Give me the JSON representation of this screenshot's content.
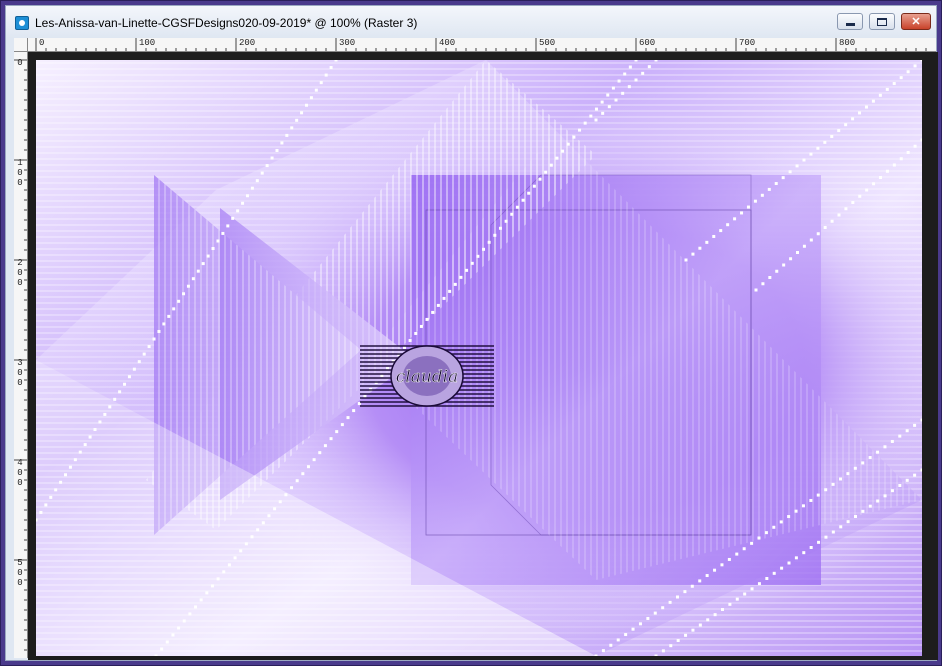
{
  "window": {
    "title": "Les-Anissa-van-Linette-CGSFDesigns020-09-2019* @ 100% (Raster 3)",
    "minimize_icon": "minimize-icon",
    "maximize_icon": "maximize-icon",
    "close_icon": "close-icon"
  },
  "ruler_top": {
    "labels": [
      "0",
      "100",
      "200",
      "300",
      "400",
      "500",
      "600",
      "700",
      "800"
    ]
  },
  "ruler_left": {
    "labels": [
      "0",
      "100",
      "200",
      "300",
      "400",
      "500"
    ]
  },
  "canvas": {
    "watermark_text": "claudia"
  },
  "colors": {
    "frame": "#4a3a8c",
    "accent_purple": "#9a6bf0",
    "light_lilac": "#e8dcff",
    "dark_purple": "#2a1458"
  }
}
